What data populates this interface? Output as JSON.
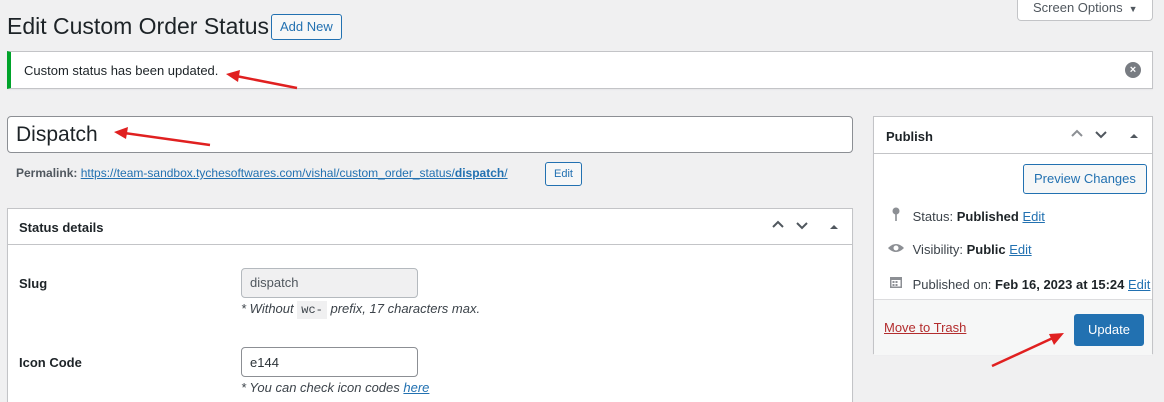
{
  "header": {
    "title": "Edit Custom Order Status",
    "add_new_label": "Add New",
    "screen_options_label": "Screen Options"
  },
  "notice": {
    "message": "Custom status has been updated."
  },
  "post": {
    "title_value": "Dispatch",
    "permalink_label": "Permalink:",
    "permalink_base": "https://team-sandbox.tychesoftwares.com/vishal/custom_order_status/",
    "permalink_slug": "dispatch",
    "permalink_trailing": "/",
    "edit_label": "Edit"
  },
  "status_details": {
    "title": "Status details",
    "slug_label": "Slug",
    "slug_value": "dispatch",
    "slug_hint_prefix": "* Without",
    "slug_hint_code": "wc-",
    "slug_hint_suffix": "prefix, 17 characters max.",
    "icon_label": "Icon Code",
    "icon_value": "e144",
    "icon_hint_prefix": "* You can check icon codes",
    "icon_hint_link": "here"
  },
  "publish": {
    "title": "Publish",
    "preview_label": "Preview Changes",
    "status_label": "Status:",
    "status_value": "Published",
    "visibility_label": "Visibility:",
    "visibility_value": "Public",
    "published_on_label": "Published on:",
    "published_on_value": "Feb 16, 2023 at 15:24",
    "edit_label": "Edit",
    "trash_label": "Move to Trash",
    "update_label": "Update"
  },
  "colors": {
    "accent": "#2271b1",
    "success": "#00a32a",
    "danger": "#b32d2e",
    "annotation_arrow": "#e02020"
  }
}
